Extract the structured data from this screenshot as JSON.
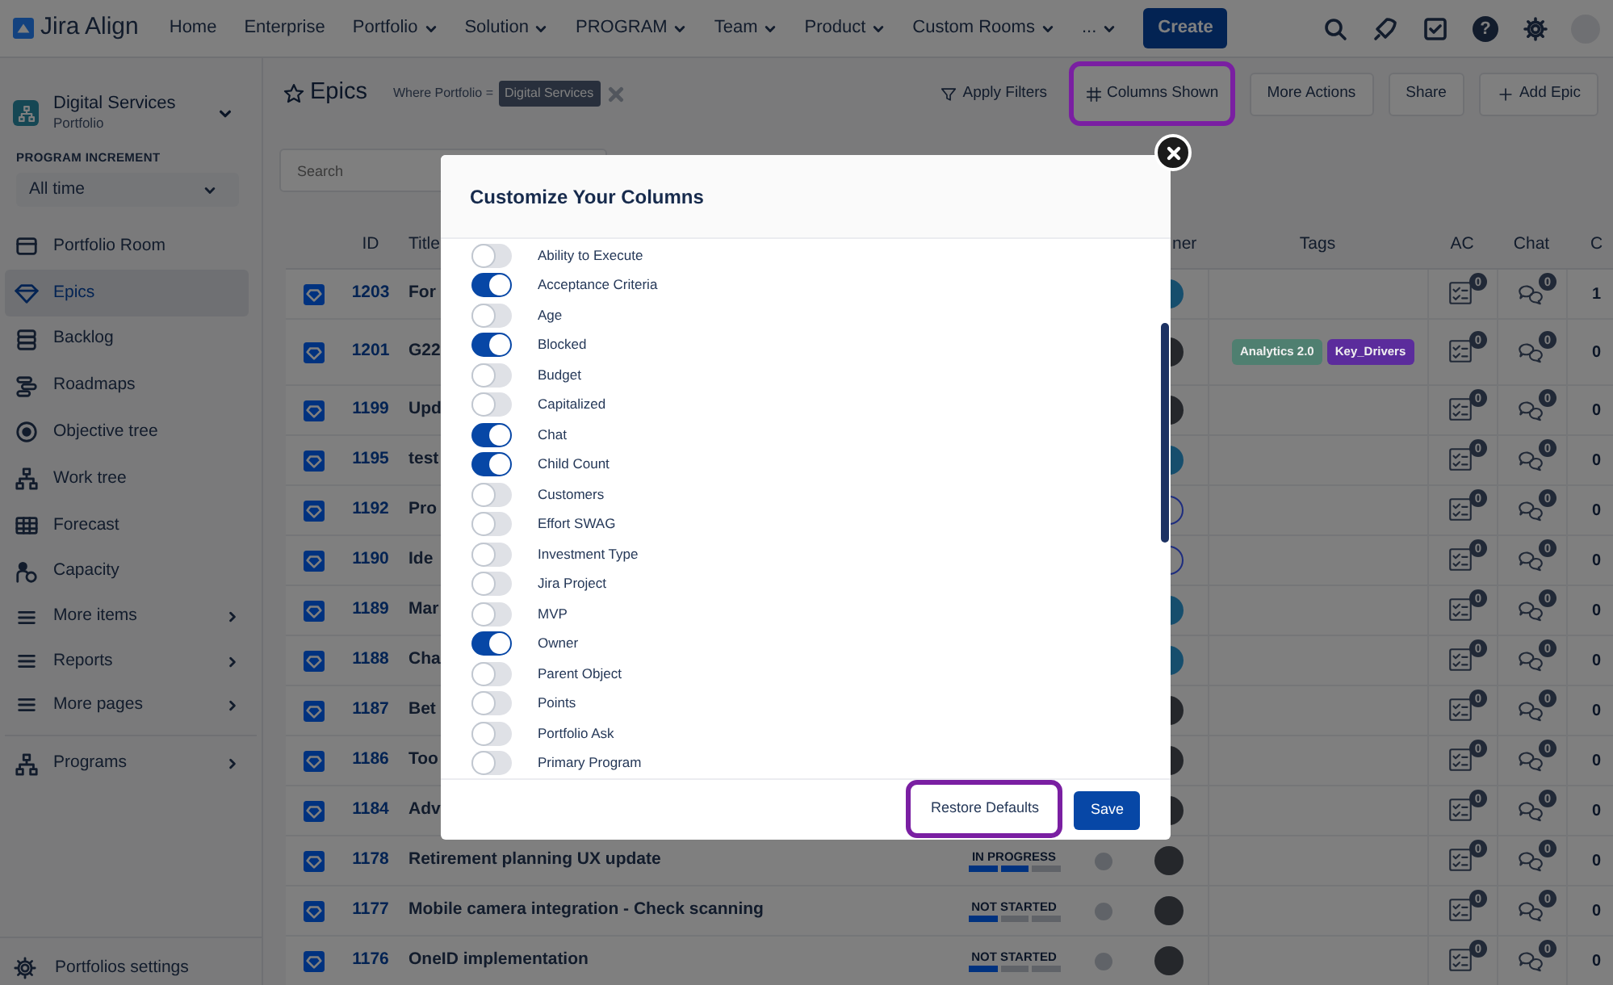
{
  "app": {
    "name": "Jira Align"
  },
  "top_nav": [
    {
      "label": "Home",
      "dropdown": false
    },
    {
      "label": "Enterprise",
      "dropdown": false
    },
    {
      "label": "Portfolio",
      "dropdown": true
    },
    {
      "label": "Solution",
      "dropdown": true
    },
    {
      "label": "PROGRAM",
      "dropdown": true
    },
    {
      "label": "Team",
      "dropdown": true
    },
    {
      "label": "Product",
      "dropdown": true
    },
    {
      "label": "Custom Rooms",
      "dropdown": true
    },
    {
      "label": "...",
      "dropdown": true
    }
  ],
  "create_button": "Create",
  "help_button": "?",
  "sidebar": {
    "context_title": "Digital Services",
    "context_subtitle": "Portfolio",
    "section_label": "PROGRAM INCREMENT",
    "increment": "All time",
    "items": [
      {
        "label": "Portfolio Room",
        "selected": false,
        "submenu": false
      },
      {
        "label": "Epics",
        "selected": true,
        "submenu": false
      },
      {
        "label": "Backlog",
        "selected": false,
        "submenu": false
      },
      {
        "label": "Roadmaps",
        "selected": false,
        "submenu": false
      },
      {
        "label": "Objective tree",
        "selected": false,
        "submenu": false
      },
      {
        "label": "Work tree",
        "selected": false,
        "submenu": false
      },
      {
        "label": "Forecast",
        "selected": false,
        "submenu": false
      },
      {
        "label": "Capacity",
        "selected": false,
        "submenu": false
      },
      {
        "label": "More items",
        "selected": false,
        "submenu": true
      },
      {
        "label": "Reports",
        "selected": false,
        "submenu": true
      },
      {
        "label": "More pages",
        "selected": false,
        "submenu": true
      }
    ],
    "secondary_items": [
      {
        "label": "Programs",
        "selected": false,
        "submenu": true
      }
    ],
    "settings": "Portfolios settings"
  },
  "toolbar": {
    "title": "Epics",
    "filter_label": "Where Portfolio =",
    "filter_chip": "Digital Services",
    "actions": [
      {
        "label": "Apply Filters",
        "kind": "link",
        "highlighted": false
      },
      {
        "label": "Columns Shown",
        "kind": "link",
        "highlighted": true
      },
      {
        "label": "More Actions",
        "kind": "button",
        "highlighted": false
      },
      {
        "label": "Share",
        "kind": "button",
        "highlighted": false
      },
      {
        "label": "Add Epic",
        "kind": "button",
        "highlighted": false
      }
    ]
  },
  "search": {
    "placeholder": "Search"
  },
  "table": {
    "columns": [
      "ID",
      "Title",
      "ner",
      "Tags",
      "AC",
      "Chat",
      "C"
    ],
    "rows": [
      {
        "id": "1203",
        "title": "For",
        "avatar": {
          "kind": "initials"
        },
        "tags": [],
        "ac_count": "0",
        "chat_count": "0",
        "count": "1"
      },
      {
        "id": "1201",
        "title": "G22",
        "avatar": {
          "kind": "photo"
        },
        "tags": [
          {
            "label": "Analytics 2.0",
            "color": "#4f7f70"
          },
          {
            "label": "Key_Drivers",
            "color": "#5b2c9c"
          }
        ],
        "ac_count": "0",
        "chat_count": "0",
        "count": "0"
      },
      {
        "id": "1199",
        "title": "Upd",
        "avatar": {
          "kind": "photo"
        },
        "tags": [],
        "ac_count": "0",
        "chat_count": "0",
        "count": "0"
      },
      {
        "id": "1195",
        "title": "test",
        "avatar": {
          "kind": "initials"
        },
        "tags": [],
        "ac_count": "0",
        "chat_count": "0",
        "count": "0"
      },
      {
        "id": "1192",
        "title": "Pro",
        "avatar": {
          "kind": "sketch"
        },
        "tags": [],
        "ac_count": "0",
        "chat_count": "0",
        "count": "0"
      },
      {
        "id": "1190",
        "title": "Ide",
        "avatar": {
          "kind": "sketch"
        },
        "tags": [],
        "ac_count": "0",
        "chat_count": "0",
        "count": "0"
      },
      {
        "id": "1189",
        "title": "Mar",
        "avatar": {
          "kind": "initials"
        },
        "tags": [],
        "ac_count": "0",
        "chat_count": "0",
        "count": "0"
      },
      {
        "id": "1188",
        "title": "Cha",
        "avatar": {
          "kind": "initials"
        },
        "tags": [],
        "ac_count": "0",
        "chat_count": "0",
        "count": "0"
      },
      {
        "id": "1187",
        "title": "Bet",
        "avatar": {
          "kind": "photo"
        },
        "tags": [],
        "ac_count": "0",
        "chat_count": "0",
        "count": "0"
      },
      {
        "id": "1186",
        "title": "Too",
        "avatar": {
          "kind": "photo"
        },
        "tags": [],
        "ac_count": "0",
        "chat_count": "0",
        "count": "0"
      },
      {
        "id": "1184",
        "title": "Adv",
        "avatar": {
          "kind": "photo"
        },
        "tags": [],
        "ac_count": "0",
        "chat_count": "0",
        "count": "0"
      },
      {
        "id": "1178",
        "title": "Retirement planning UX update",
        "status": {
          "label": "IN PROGRESS",
          "level": 0.67
        },
        "blocked": false,
        "avatar": {
          "kind": "photo"
        },
        "tags": [],
        "ac_count": "0",
        "chat_count": "0",
        "count": "0"
      },
      {
        "id": "1177",
        "title": "Mobile camera integration - Check scanning",
        "status": {
          "label": "NOT STARTED",
          "level": 0.33
        },
        "blocked": false,
        "avatar": {
          "kind": "photo"
        },
        "tags": [],
        "ac_count": "0",
        "chat_count": "0",
        "count": "0"
      },
      {
        "id": "1176",
        "title": "OneID implementation",
        "status": {
          "label": "NOT STARTED",
          "level": 0.33
        },
        "blocked": false,
        "avatar": {
          "kind": "photo"
        },
        "tags": [],
        "ac_count": "0",
        "chat_count": "0",
        "count": "0"
      }
    ]
  },
  "modal": {
    "title": "Customize Your Columns",
    "columns": [
      {
        "label": "Ability to Execute",
        "on": false
      },
      {
        "label": "Acceptance Criteria",
        "on": true
      },
      {
        "label": "Age",
        "on": false
      },
      {
        "label": "Blocked",
        "on": true
      },
      {
        "label": "Budget",
        "on": false
      },
      {
        "label": "Capitalized",
        "on": false
      },
      {
        "label": "Chat",
        "on": true
      },
      {
        "label": "Child Count",
        "on": true
      },
      {
        "label": "Customers",
        "on": false
      },
      {
        "label": "Effort SWAG",
        "on": false
      },
      {
        "label": "Investment Type",
        "on": false
      },
      {
        "label": "Jira Project",
        "on": false
      },
      {
        "label": "MVP",
        "on": false
      },
      {
        "label": "Owner",
        "on": true
      },
      {
        "label": "Parent Object",
        "on": false
      },
      {
        "label": "Points",
        "on": false
      },
      {
        "label": "Portfolio Ask",
        "on": false
      },
      {
        "label": "Primary Program",
        "on": false
      }
    ],
    "buttons": [
      {
        "label": "Restore Defaults",
        "kind": "secondary",
        "highlighted": true
      },
      {
        "label": "Save",
        "kind": "primary",
        "highlighted": false
      }
    ]
  }
}
